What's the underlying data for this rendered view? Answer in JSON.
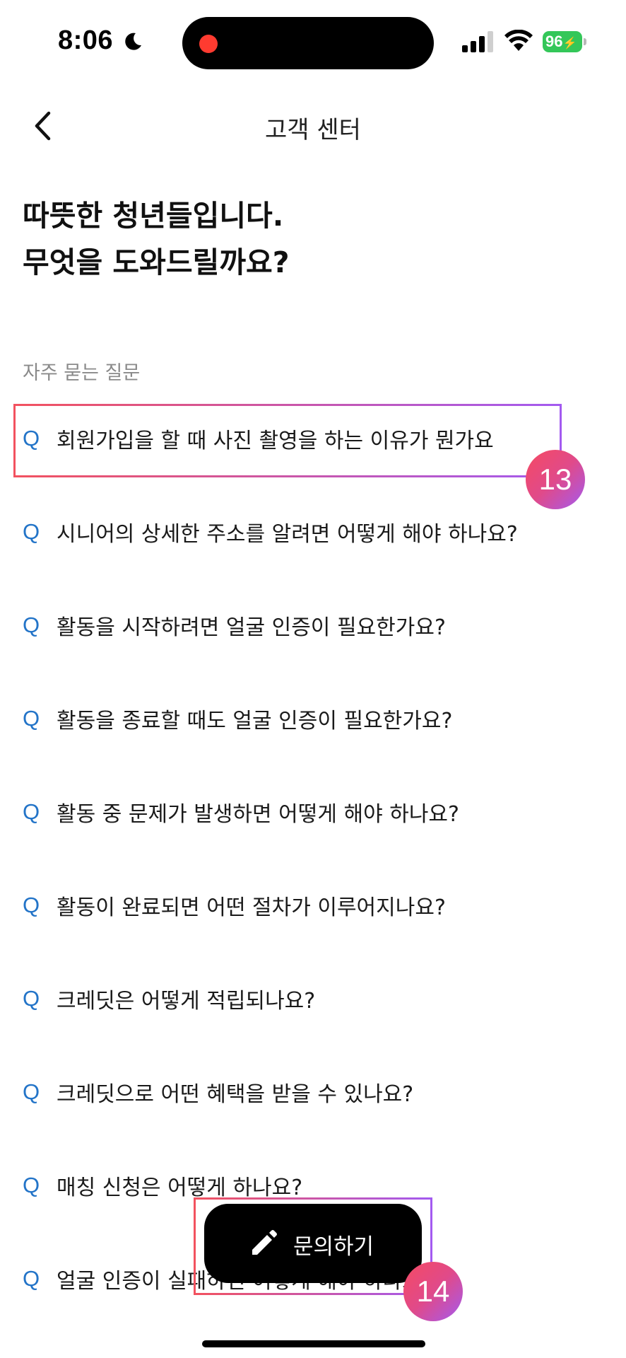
{
  "status_bar": {
    "time": "8:06",
    "battery": "96"
  },
  "nav": {
    "title": "고객 센터"
  },
  "headline": {
    "line1": "따뜻한 청년들입니다.",
    "line2": "무엇을 도와드릴까요?"
  },
  "faq": {
    "section_label": "자주 묻는 질문",
    "q_marker": "Q",
    "items": [
      {
        "question": "회원가입을 할 때 사진 촬영을 하는 이유가 뭔가요"
      },
      {
        "question": "시니어의 상세한 주소를 알려면 어떻게 해야 하나요?"
      },
      {
        "question": "활동을 시작하려면 얼굴 인증이 필요한가요?"
      },
      {
        "question": "활동을 종료할 때도 얼굴 인증이 필요한가요?"
      },
      {
        "question": "활동 중 문제가 발생하면 어떻게 해야 하나요?"
      },
      {
        "question": "활동이 완료되면 어떤 절차가 이루어지나요?"
      },
      {
        "question": "크레딧은 어떻게 적립되나요?"
      },
      {
        "question": "크레딧으로 어떤 혜택을 받을 수 있나요?"
      },
      {
        "question": "매칭 신청은 어떻게 하나요?"
      },
      {
        "question": "얼굴 인증이 실패하면 어떻게 해야 하나요?"
      }
    ]
  },
  "fab": {
    "label": "문의하기",
    "icon": "pencil-icon"
  },
  "annotations": {
    "badge_13": "13",
    "badge_14": "14"
  },
  "colors": {
    "q_marker": "#2374c8",
    "battery": "#34c759",
    "recording_dot": "#ff3b30",
    "annotation_gradient_start": "#f2525f",
    "annotation_gradient_end": "#a35af0"
  }
}
